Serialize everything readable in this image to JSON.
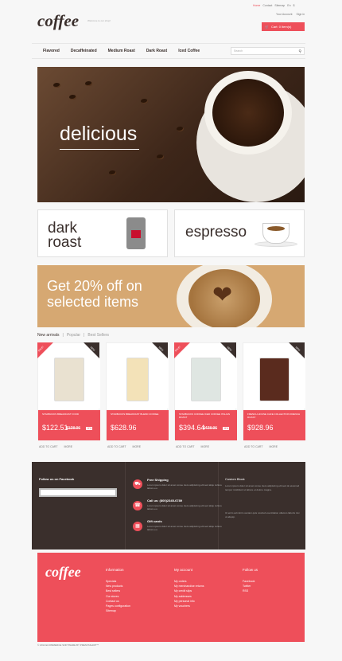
{
  "header": {
    "logo": "coffee",
    "tagline": "Welcome to our shop!",
    "top_links": [
      "Home",
      "Contact",
      "Sitemap",
      "En",
      "$"
    ],
    "account_links": [
      "Your Account",
      "Sign in"
    ],
    "cart_label": "Cart: 0 item(s)",
    "search_placeholder": "Search"
  },
  "nav": {
    "items": [
      "Flavored",
      "Decaffeinated",
      "Medium Roast",
      "Dark Roast",
      "Iced Coffee"
    ]
  },
  "hero": {
    "title": "delicious"
  },
  "banners": {
    "left": "dark roast",
    "right": "espresso",
    "promo": "Get 20% off on selected items"
  },
  "tabs": [
    "New arrivals",
    "Popular",
    "Best Sellers"
  ],
  "products": [
    {
      "name": "STARBUCKS BREAKFAST FOOD",
      "price": "$122.51",
      "old": "$128.96",
      "discount": "-5%",
      "sale": true,
      "new": true
    },
    {
      "name": "STARBUCKS BREAKFAST BLEND COFFEE",
      "price": "$628.96",
      "old": "",
      "discount": "",
      "sale": false,
      "new": true
    },
    {
      "name": "STARBUCKS COFFEE ICED COFFEE ITALIAN ROAST",
      "price": "$394.64",
      "old": "$428.96",
      "discount": "-8%",
      "sale": true,
      "new": true
    },
    {
      "name": "FRENCH HOUSE CAFE COLLECTION FRENCH ROAST",
      "price": "$928.96",
      "old": "",
      "discount": "",
      "sale": false,
      "new": true
    }
  ],
  "product_actions": [
    "ADD TO CART",
    "MORE"
  ],
  "tag_labels": {
    "sale": "SALE!",
    "new": "NEW"
  },
  "info": {
    "facebook_title": "Follow us on Facebook",
    "shipping_title": "Free Shipping",
    "shipping_text": "Lorem ipsum dolor sit amet conse ctetu adipiscing elit sed aliqu culture labore eu.",
    "call_title": "Call us: (800)2345-6789",
    "call_text": "Lorem ipsum dolor sit amet conse ctetu adipiscing elit sed aliqu culture labore eu.",
    "gift_title": "Gift cards",
    "gift_text": "Lorem ipsum dolor sit amet conse ctetu adipiscing elit sed aliqu culture labore eu.",
    "custom_title": "Custom Block",
    "custom_text1": "Lorem ipsum dolor sit amet conse ctetu adipiscing elit sed do eiusmod tempor incididunt ut labore et dolore magna.",
    "custom_text2": "Ut enim ad minim veniam quis nostrud exercitation ullamco laboris nisi ut aliquip."
  },
  "footer": {
    "logo": "coffee",
    "info_title": "Information",
    "info_links": [
      "Specials",
      "New products",
      "Best sellers",
      "Our stores",
      "Contact us",
      "Pages configuration",
      "Sitemap"
    ],
    "account_title": "My account",
    "account_links": [
      "My orders",
      "My merchandise returns",
      "My credit slips",
      "My addresses",
      "My personal info",
      "My vouchers"
    ],
    "follow_title": "Follow us",
    "follow_links": [
      "Facebook",
      "Twitter",
      "RSS"
    ],
    "copyright": "© 2014 ECOMMERCE SOFTWARE BY PRESTASHOP™"
  }
}
